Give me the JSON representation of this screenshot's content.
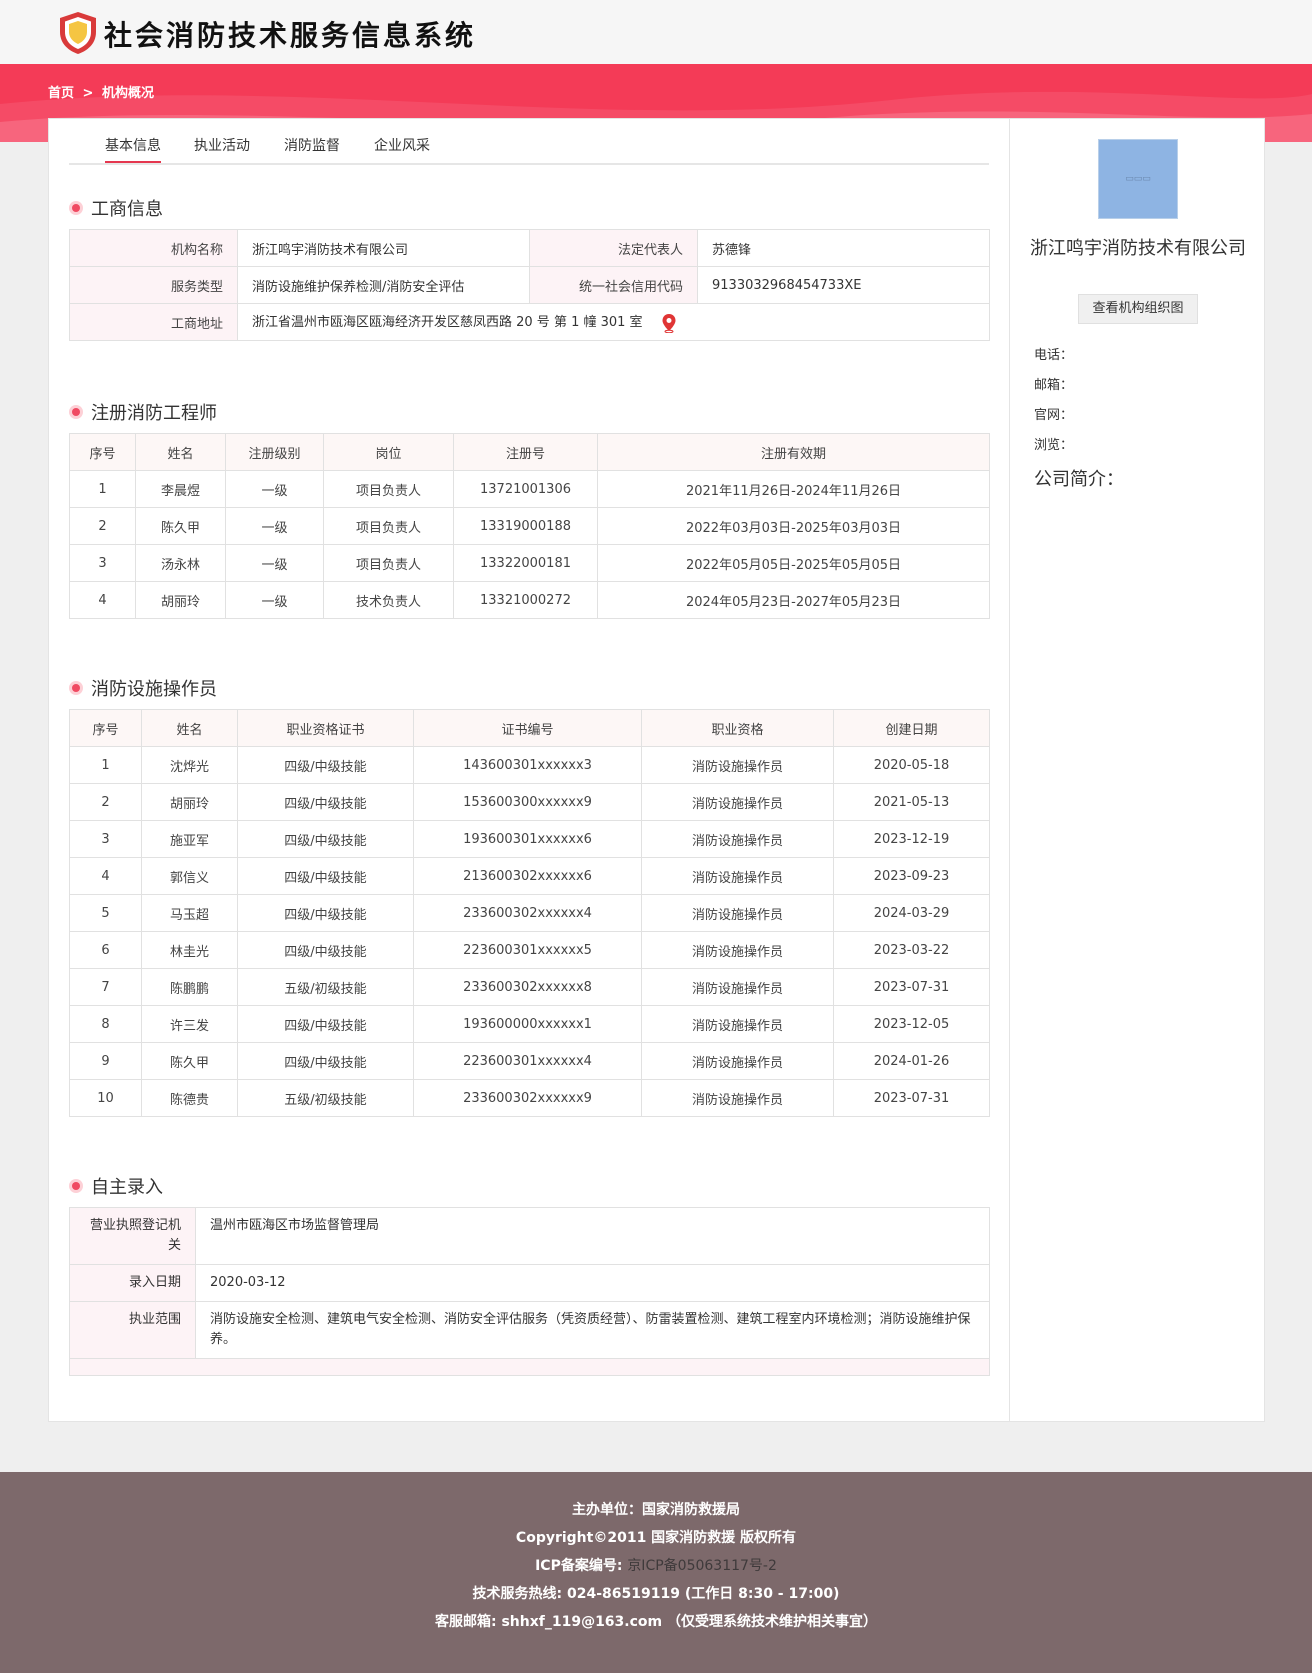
{
  "header": {
    "site_title": "社会消防技术服务信息系统"
  },
  "breadcrumb": {
    "home": "首页",
    "separator": ">",
    "current": "机构概况"
  },
  "tabs": [
    "基本信息",
    "执业活动",
    "消防监督",
    "企业风采"
  ],
  "business": {
    "title": "工商信息",
    "org_name_label": "机构名称",
    "org_name": "浙江鸣宇消防技术有限公司",
    "legal_rep_label": "法定代表人",
    "legal_rep": "苏德锋",
    "service_type_label": "服务类型",
    "service_type": "消防设施维护保养检测/消防安全评估",
    "credit_code_label": "统一社会信用代码",
    "credit_code": "9133032968454733XE",
    "address_label": "工商地址",
    "address": "浙江省温州市瓯海区瓯海经济开发区慈凤西路 20 号 第 1 幢 301 室"
  },
  "engineers": {
    "title": "注册消防工程师",
    "headers": [
      "序号",
      "姓名",
      "注册级别",
      "岗位",
      "注册号",
      "注册有效期"
    ],
    "rows": [
      [
        "1",
        "李晨煜",
        "一级",
        "项目负责人",
        "13721001306",
        "2021年11月26日-2024年11月26日"
      ],
      [
        "2",
        "陈久甲",
        "一级",
        "项目负责人",
        "13319000188",
        "2022年03月03日-2025年03月03日"
      ],
      [
        "3",
        "汤永林",
        "一级",
        "项目负责人",
        "13322000181",
        "2022年05月05日-2025年05月05日"
      ],
      [
        "4",
        "胡丽玲",
        "一级",
        "技术负责人",
        "13321000272",
        "2024年05月23日-2027年05月23日"
      ]
    ]
  },
  "operators": {
    "title": "消防设施操作员",
    "headers": [
      "序号",
      "姓名",
      "职业资格证书",
      "证书编号",
      "职业资格",
      "创建日期"
    ],
    "rows": [
      [
        "1",
        "沈烨光",
        "四级/中级技能",
        "143600301xxxxxx3",
        "消防设施操作员",
        "2020-05-18"
      ],
      [
        "2",
        "胡丽玲",
        "四级/中级技能",
        "153600300xxxxxx9",
        "消防设施操作员",
        "2021-05-13"
      ],
      [
        "3",
        "施亚军",
        "四级/中级技能",
        "193600301xxxxxx6",
        "消防设施操作员",
        "2023-12-19"
      ],
      [
        "4",
        "郭信义",
        "四级/中级技能",
        "213600302xxxxxx6",
        "消防设施操作员",
        "2023-09-23"
      ],
      [
        "5",
        "马玉超",
        "四级/中级技能",
        "233600302xxxxxx4",
        "消防设施操作员",
        "2024-03-29"
      ],
      [
        "6",
        "林圭光",
        "四级/中级技能",
        "223600301xxxxxx5",
        "消防设施操作员",
        "2023-03-22"
      ],
      [
        "7",
        "陈鹏鹏",
        "五级/初级技能",
        "233600302xxxxxx8",
        "消防设施操作员",
        "2023-07-31"
      ],
      [
        "8",
        "许三发",
        "四级/中级技能",
        "193600000xxxxxx1",
        "消防设施操作员",
        "2023-12-05"
      ],
      [
        "9",
        "陈久甲",
        "四级/中级技能",
        "223600301xxxxxx4",
        "消防设施操作员",
        "2024-01-26"
      ],
      [
        "10",
        "陈德贵",
        "五级/初级技能",
        "233600302xxxxxx9",
        "消防设施操作员",
        "2023-07-31"
      ]
    ]
  },
  "self_entry": {
    "title": "自主录入",
    "reg_authority_label": "营业执照登记机关",
    "reg_authority": "温州市瓯海区市场监督管理局",
    "entry_date_label": "录入日期",
    "entry_date": "2020-03-12",
    "scope_label": "执业范围",
    "scope": "消防设施安全检测、建筑电气安全检测、消防安全评估服务（凭资质经营）、防雷装置检测、建筑工程室内环境检测；消防设施维护保养。"
  },
  "sidebar": {
    "company_name": "浙江鸣宇消防技术有限公司",
    "org_chart_button": "查看机构组织图",
    "phone_label": "电话：",
    "email_label": "邮箱：",
    "website_label": "官网：",
    "views_label": "浏览：",
    "intro_label": "公司简介："
  },
  "footer": {
    "host": "主办单位：国家消防救援局",
    "copyright": "Copyright©2011 国家消防救援 版权所有",
    "icp_label": "ICP备案编号:",
    "icp_value": "京ICP备05063117号-2",
    "hotline": "技术服务热线: 024-86519119 (工作日 8:30 - 17:00)",
    "service_email": "客服邮箱: shhxf_119@163.com （仅受理系统技术维护相关事宜）"
  },
  "colors": {
    "accent": "#f43b57",
    "footer_bg": "#7d696b",
    "label_bg": "#fdf3f6"
  }
}
